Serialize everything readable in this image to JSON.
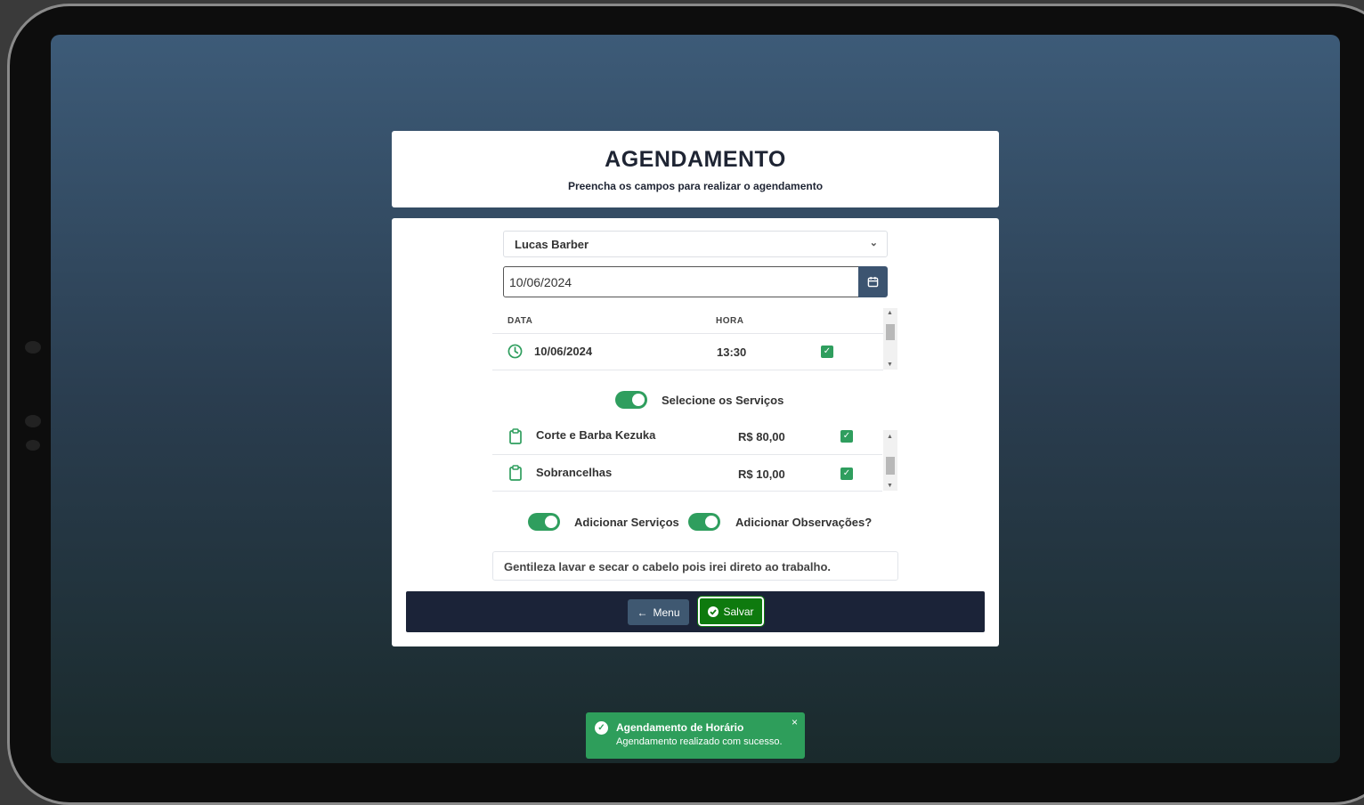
{
  "header": {
    "title": "AGENDAMENTO",
    "subtitle": "Preencha os campos para realizar o agendamento"
  },
  "form": {
    "barber_select": "Lucas Barber",
    "date_value": "10/06/2024",
    "schedule_table": {
      "headers": [
        "DATA",
        "HORA"
      ],
      "rows": [
        {
          "date": "10/06/2024",
          "time": "13:30",
          "checked": true
        }
      ]
    },
    "services_toggle_label": "Selecione os Serviços",
    "services": [
      {
        "name": "Corte e Barba Kezuka",
        "price": "R$ 80,00",
        "checked": true
      },
      {
        "name": "Sobrancelhas",
        "price": "R$ 10,00",
        "checked": true
      }
    ],
    "add_services_label": "Adicionar Serviços",
    "add_notes_label": "Adicionar Observações?",
    "notes_value": "Gentileza lavar e secar o cabelo pois irei direto ao trabalho."
  },
  "footer": {
    "menu_label": "Menu",
    "save_label": "Salvar"
  },
  "toast": {
    "title": "Agendamento de Horário",
    "message": "Agendamento realizado com sucesso.",
    "close": "×"
  },
  "colors": {
    "accent_green": "#2f9e5e",
    "save_green": "#0e7a0e",
    "footer_navy": "#1b2338",
    "menu_button": "#3f5871"
  }
}
